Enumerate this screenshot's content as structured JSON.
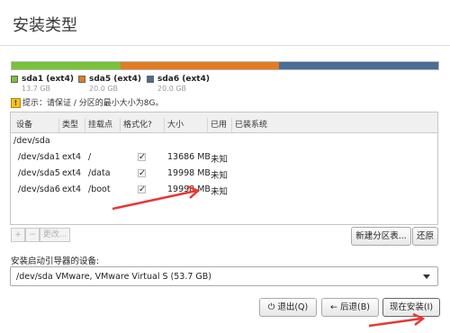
{
  "window": {
    "title": "安装类型"
  },
  "partition_bar": {
    "segments": [
      {
        "name": "sda1 (ext4)",
        "size": "13.7 GB",
        "color": "#78c23b",
        "fraction": 0.2546
      },
      {
        "name": "sda5 (ext4)",
        "size": "20.0 GB",
        "color": "#e07c22",
        "fraction": 0.3727
      },
      {
        "name": "sda6 (ext4)",
        "size": "20.0 GB",
        "color": "#4a6d96",
        "fraction": 0.3727
      }
    ]
  },
  "tip": {
    "icon": "warning-icon",
    "text": "提示：请保证 / 分区的最小大小为8G。"
  },
  "table": {
    "headers": [
      "设备",
      "类型",
      "挂载点",
      "格式化?",
      "大小",
      "已用",
      "已装系统"
    ],
    "disk_label": "/dev/sda",
    "rows": [
      {
        "device": "/dev/sda1",
        "type": "ext4",
        "mount": "/",
        "format": true,
        "size": "13686 MB",
        "used": "未知",
        "system": ""
      },
      {
        "device": "/dev/sda5",
        "type": "ext4",
        "mount": "/data",
        "format": true,
        "size": "19998 MB",
        "used": "未知",
        "system": ""
      },
      {
        "device": "/dev/sda6",
        "type": "ext4",
        "mount": "/boot",
        "format": true,
        "size": "19998 MB",
        "used": "未知",
        "system": ""
      }
    ]
  },
  "table_actions": {
    "add": "+",
    "remove": "−",
    "change": "更改..."
  },
  "buttons": {
    "new_table": "新建分区表...",
    "revert": "还原"
  },
  "bootloader": {
    "label": "安装启动引导器的设备:",
    "selected": "/dev/sda   VMware, VMware Virtual S (53.7 GB)"
  },
  "footer": {
    "quit": "退出(Q)",
    "back": "后退(B)",
    "install": "现在安装(I)"
  }
}
